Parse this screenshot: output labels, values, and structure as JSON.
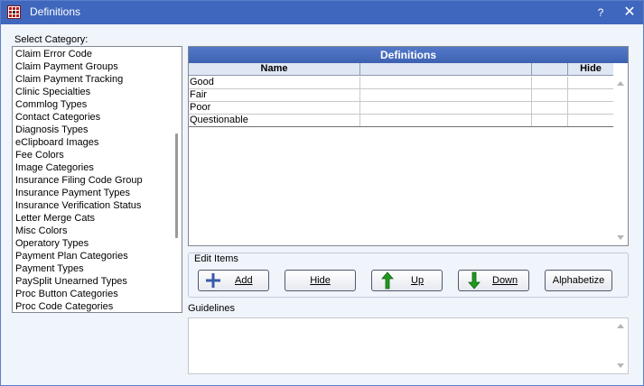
{
  "window": {
    "title": "Definitions",
    "help_label": "?",
    "close_label": "✕"
  },
  "select_category_label": "Select Category:",
  "categories": [
    "Claim Error Code",
    "Claim Payment Groups",
    "Claim Payment Tracking",
    "Clinic Specialties",
    "Commlog Types",
    "Contact Categories",
    "Diagnosis Types",
    "eClipboard Images",
    "Fee Colors",
    "Image Categories",
    "Insurance Filing Code Group",
    "Insurance Payment Types",
    "Insurance Verification Status",
    "Letter Merge Cats",
    "Misc Colors",
    "Operatory Types",
    "Payment Plan Categories",
    "Payment Types",
    "PaySplit Unearned Types",
    "Proc Button Categories",
    "Proc Code Categories"
  ],
  "grid": {
    "title": "Definitions",
    "columns": [
      "Name",
      "",
      "",
      "Hide"
    ],
    "rows": [
      {
        "name": "Good",
        "c2": "",
        "c3": "",
        "hide": ""
      },
      {
        "name": "Fair",
        "c2": "",
        "c3": "",
        "hide": ""
      },
      {
        "name": "Poor",
        "c2": "",
        "c3": "",
        "hide": ""
      },
      {
        "name": "Questionable",
        "c2": "",
        "c3": "",
        "hide": ""
      }
    ]
  },
  "edit_items": {
    "label": "Edit Items",
    "add": "Add",
    "hide": "Hide",
    "up": "Up",
    "down": "Down",
    "alphabetize": "Alphabetize"
  },
  "guidelines_label": "Guidelines",
  "guidelines_text": "",
  "colors": {
    "titlebar": "#3f67bd",
    "grid_title": "#4a6fc2",
    "arrow_green": "#1f9a1f",
    "add_plus": "#3a5aa8"
  },
  "icons": {
    "app": "grid-app-icon",
    "add": "plus-icon",
    "up": "green-up-arrow-icon",
    "down": "green-down-arrow-icon"
  }
}
